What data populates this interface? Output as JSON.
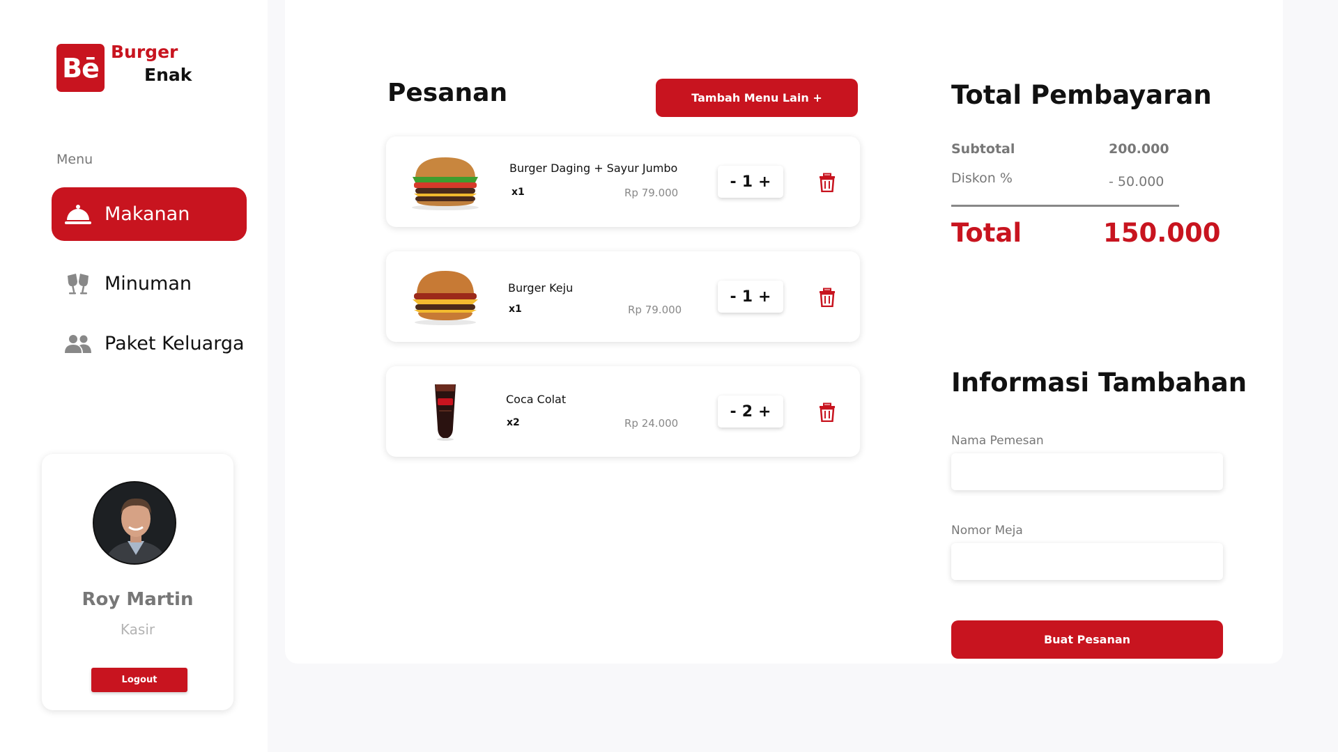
{
  "brand": {
    "mark": "Bē",
    "line1": "Burger",
    "line2": "Enak",
    "accent_color": "#c8141f"
  },
  "sidebar": {
    "menu_heading": "Menu",
    "items": [
      {
        "label": "Makanan",
        "icon": "cloche-icon",
        "active": true
      },
      {
        "label": "Minuman",
        "icon": "toast-glasses-icon",
        "active": false
      },
      {
        "label": "Paket Keluarga",
        "icon": "users-icon",
        "active": false
      }
    ]
  },
  "profile": {
    "name": "Roy Martin",
    "role": "Kasir",
    "logout_label": "Logout"
  },
  "orders": {
    "title": "Pesanan",
    "add_button_label": "Tambah Menu Lain +",
    "items": [
      {
        "name": "Burger Daging + Sayur Jumbo",
        "qty_label": "x1",
        "price": "Rp 79.000",
        "quantity": "1",
        "minus": "-",
        "plus": "+",
        "image": "burger-image"
      },
      {
        "name": "Burger Keju",
        "qty_label": "x1",
        "price": "Rp 79.000",
        "quantity": "1",
        "minus": "-",
        "plus": "+",
        "image": "cheeseburger-image"
      },
      {
        "name": "Coca Colat",
        "qty_label": "x2",
        "price": "Rp 24.000",
        "quantity": "2",
        "minus": "-",
        "plus": "+",
        "image": "cola-glass-image"
      }
    ]
  },
  "payment": {
    "title": "Total Pembayaran",
    "subtotal_label": "Subtotal",
    "subtotal_value": "200.000",
    "discount_label": "Diskon %",
    "discount_value": "- 50.000",
    "total_label": "Total",
    "total_value": "150.000"
  },
  "extra_info": {
    "title": "Informasi Tambahan",
    "name_label": "Nama Pemesan",
    "name_value": "",
    "table_label": "Nomor Meja",
    "table_value": "",
    "submit_label": "Buat Pesanan"
  }
}
